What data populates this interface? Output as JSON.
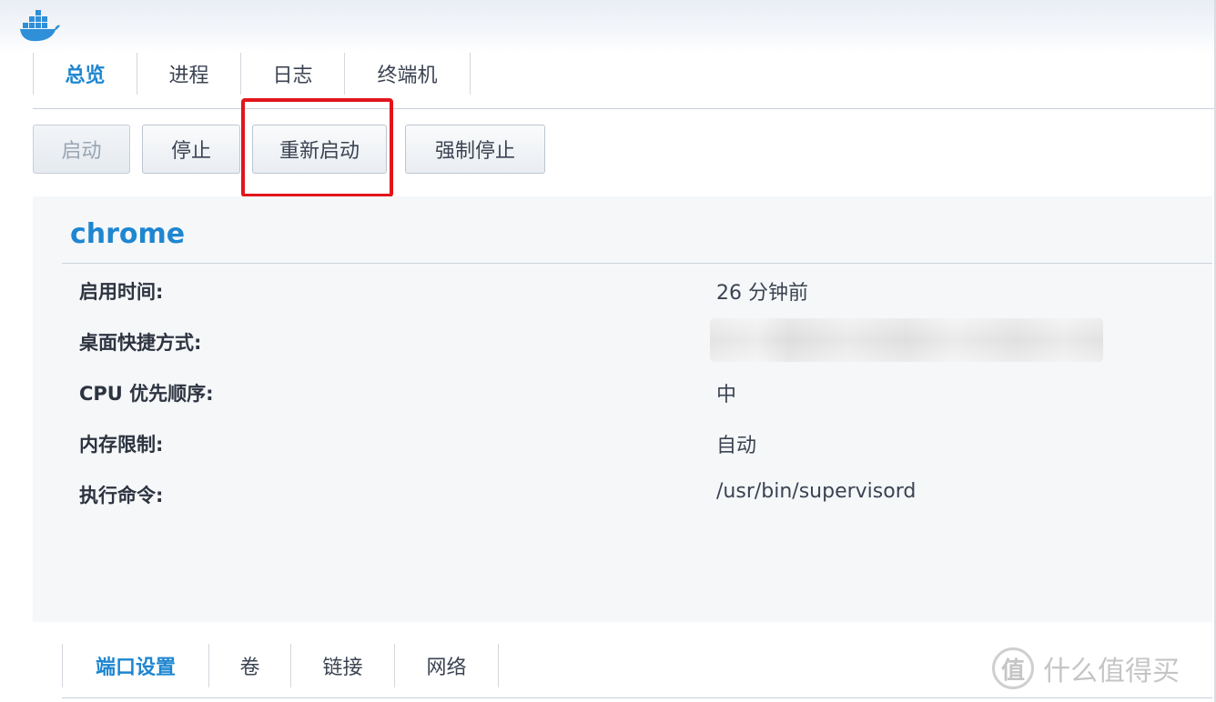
{
  "top_tabs": [
    {
      "label": "总览",
      "active": true
    },
    {
      "label": "进程",
      "active": false
    },
    {
      "label": "日志",
      "active": false
    },
    {
      "label": "终端机",
      "active": false
    }
  ],
  "toolbar": {
    "start_label": "启动",
    "stop_label": "停止",
    "restart_label": "重新启动",
    "force_stop_label": "强制停止"
  },
  "container": {
    "name": "chrome",
    "rows": [
      {
        "label": "启用时间:",
        "value": "26 分钟前"
      },
      {
        "label": "桌面快捷方式:",
        "value": ""
      },
      {
        "label": "CPU 优先顺序:",
        "value": "中"
      },
      {
        "label": "内存限制:",
        "value": "自动"
      },
      {
        "label": "执行命令:",
        "value": "/usr/bin/supervisord"
      }
    ]
  },
  "bottom_tabs": [
    {
      "label": "端口设置",
      "active": true
    },
    {
      "label": "卷",
      "active": false
    },
    {
      "label": "链接",
      "active": false
    },
    {
      "label": "网络",
      "active": false
    }
  ],
  "watermark": {
    "badge": "值",
    "text": "什么值得买"
  },
  "colors": {
    "accent": "#1f86d0",
    "highlight": "#e2151b"
  }
}
